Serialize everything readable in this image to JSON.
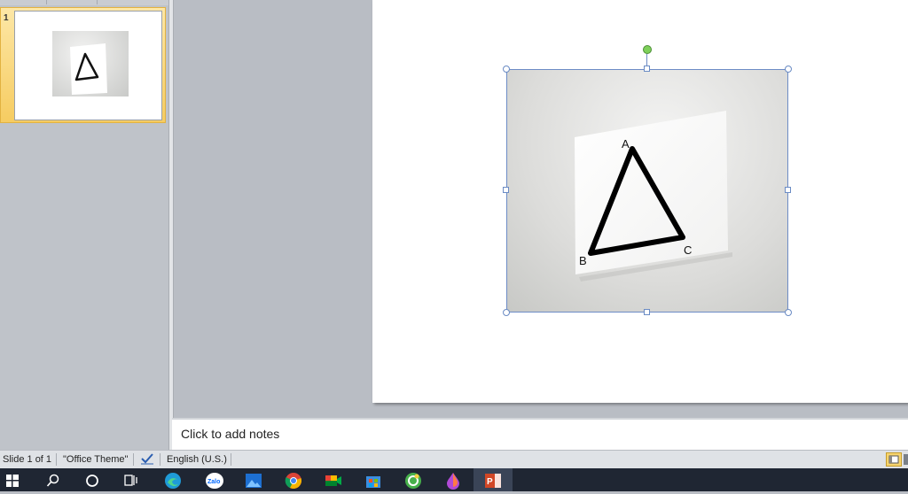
{
  "slide_panel": {
    "slide_number": "1"
  },
  "picture": {
    "label_a": "A",
    "label_b": "B",
    "label_c": "C"
  },
  "notes": {
    "placeholder": "Click to add notes"
  },
  "status_bar": {
    "slide_indicator": "Slide 1 of 1",
    "theme": "\"Office Theme\"",
    "language": "English (U.S.)"
  },
  "taskbar": {
    "zalo_label": "Zalo",
    "icons": [
      "windows-start-icon",
      "search-icon",
      "cortana-icon",
      "task-view-icon",
      "edge-icon",
      "zalo-icon",
      "photos-icon",
      "chrome-icon",
      "google-meet-icon",
      "store-icon",
      "app-icon",
      "paint-icon",
      "powerpoint-icon"
    ]
  },
  "colors": {
    "accent": "#f6cc61",
    "selection": "#6d8cc6",
    "rotate_handle": "#7ed05a",
    "taskbar": "#1f2633"
  }
}
